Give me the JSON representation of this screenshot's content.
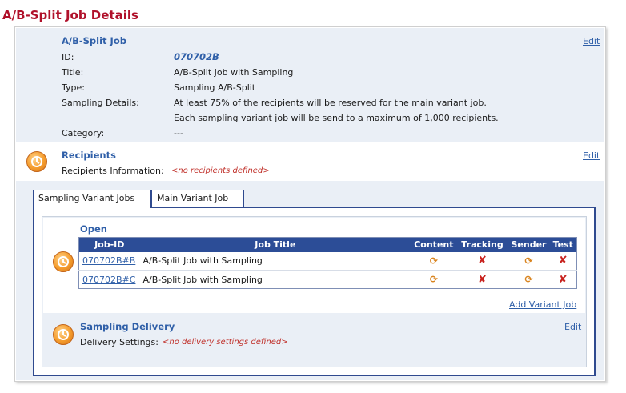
{
  "page_title": "A/B-Split Job Details",
  "job": {
    "section_title": "A/B-Split Job",
    "edit_label": "Edit",
    "fields": {
      "id_label": "ID:",
      "id_value": "070702B",
      "title_label": "Title:",
      "title_value": "A/B-Split Job with Sampling",
      "type_label": "Type:",
      "type_value": "Sampling A/B-Split",
      "sampling_label": "Sampling Details:",
      "sampling_line1": "At least 75% of the recipients will be reserved for the main variant job.",
      "sampling_line2": "Each sampling variant job will be send to a maximum of 1,000 recipients.",
      "category_label": "Category:",
      "category_value": "---"
    }
  },
  "recipients": {
    "section_title": "Recipients",
    "edit_label": "Edit",
    "info_label": "Recipients Information:",
    "info_value": "<no recipients defined>"
  },
  "tabs": [
    {
      "label": "Sampling Variant Jobs",
      "active": true
    },
    {
      "label": "Main Variant Job",
      "active": false
    }
  ],
  "open": {
    "title": "Open",
    "columns": [
      "Job-ID",
      "Job Title",
      "Content",
      "Tracking",
      "Sender",
      "Test"
    ],
    "rows": [
      {
        "job_id": "070702B#B",
        "job_title": "A/B-Split Job with Sampling",
        "content": "sync-icon",
        "tracking": "x-icon",
        "sender": "sync-icon",
        "test": "x-icon"
      },
      {
        "job_id": "070702B#C",
        "job_title": "A/B-Split Job with Sampling",
        "content": "sync-icon",
        "tracking": "x-icon",
        "sender": "sync-icon",
        "test": "x-icon"
      }
    ],
    "add_label": "Add Variant Job"
  },
  "delivery": {
    "section_title": "Sampling Delivery",
    "edit_label": "Edit",
    "settings_label": "Delivery Settings:",
    "settings_value": "<no delivery settings defined>"
  },
  "colors": {
    "title_red": "#b0102a",
    "link_blue": "#2f5fa8",
    "header_blue": "#2c4d97",
    "section_bg": "#eaeff6",
    "status_orange": "#d9841f",
    "status_red": "#c8221e"
  }
}
